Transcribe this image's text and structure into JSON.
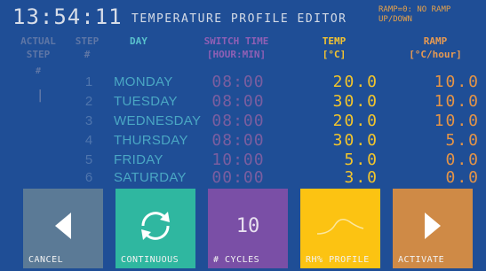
{
  "clock": "13:54:11",
  "title": "TEMPERATURE PROFILE EDITOR",
  "ramp_note": "RAMP=0: NO RAMP UP/DOWN",
  "headers": {
    "actual_step": [
      "ACTUAL",
      "STEP"
    ],
    "step": [
      "STEP",
      "#"
    ],
    "day": "DAY",
    "switch_time": [
      "SWITCH TIME",
      "[HOUR:MIN]"
    ],
    "temp": [
      "TEMP",
      "[°C]"
    ],
    "ramp": [
      "RAMP",
      "[°C/hour]"
    ]
  },
  "actual_marker": "#",
  "active_marker": "|",
  "rows": [
    {
      "step": "1",
      "day": "MONDAY",
      "time": "08:00",
      "temp": "20.0",
      "ramp": "10.0"
    },
    {
      "step": "2",
      "day": "TUESDAY",
      "time": "08:00",
      "temp": "30.0",
      "ramp": "10.0"
    },
    {
      "step": "3",
      "day": "WEDNESDAY",
      "time": "08:00",
      "temp": "20.0",
      "ramp": "10.0"
    },
    {
      "step": "4",
      "day": "THURSDAY",
      "time": "08:00",
      "temp": "30.0",
      "ramp": "5.0"
    },
    {
      "step": "5",
      "day": "FRIDAY",
      "time": "10:00",
      "temp": "5.0",
      "ramp": "0.0"
    },
    {
      "step": "6",
      "day": "SATURDAY",
      "time": "00:00",
      "temp": "3.0",
      "ramp": "0.0"
    }
  ],
  "buttons": {
    "cancel": "CANCEL",
    "continuous": "CONTINUOUS",
    "cycles": "# CYCLES",
    "cycles_value": "10",
    "rh_profile": "RH% PROFILE",
    "activate": "ACTIVATE"
  },
  "colors": {
    "background": "#1f4e96",
    "cancel": "#5b7a96",
    "continuous": "#2fb7a0",
    "cycles": "#7a4fa6",
    "rh_profile": "#fcc312",
    "activate": "#cf8a46"
  }
}
